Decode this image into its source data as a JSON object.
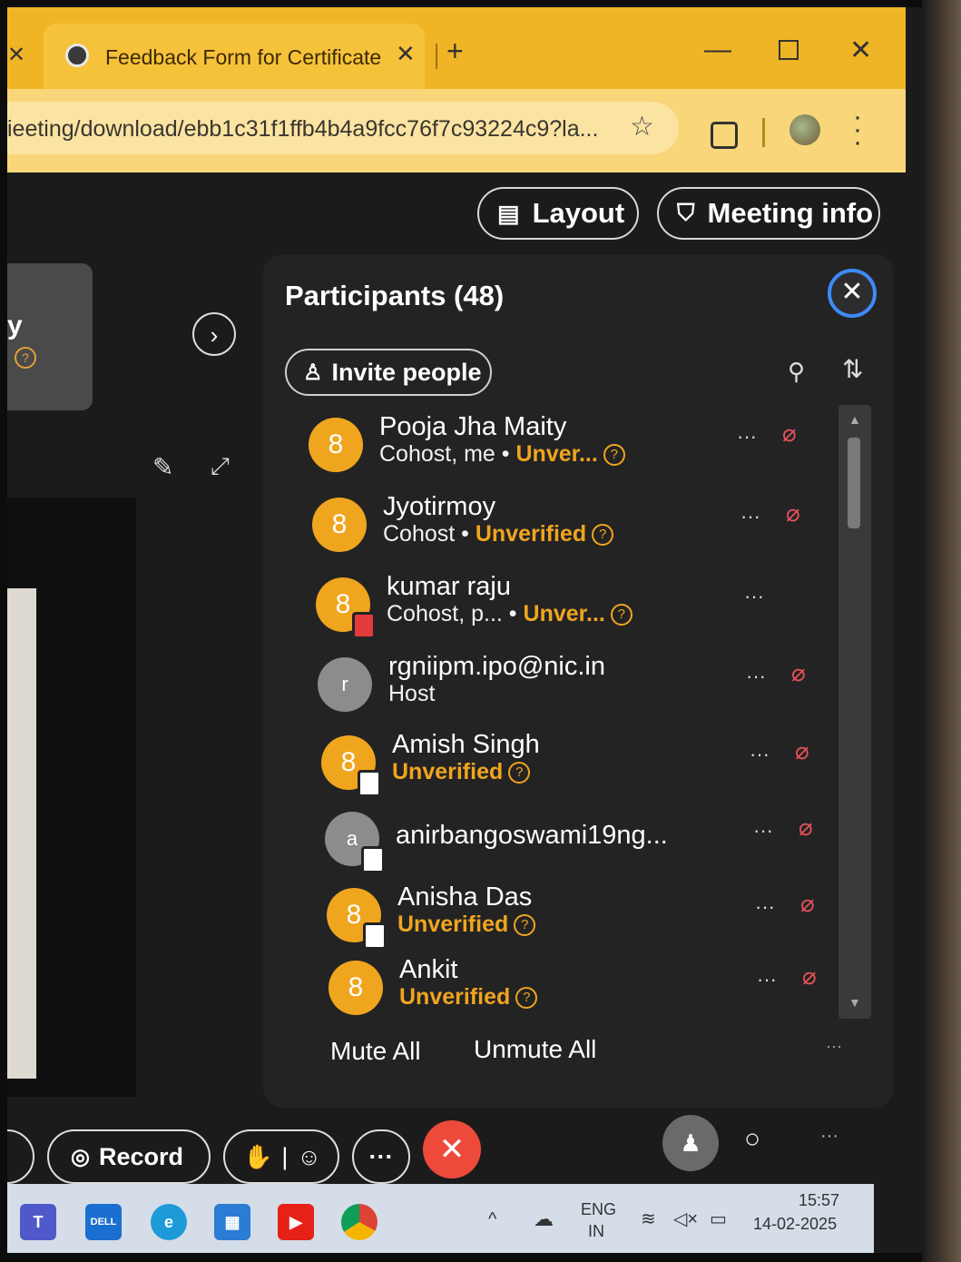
{
  "browser": {
    "tab_title": "Feedback Form for Certificate",
    "url": "ieeting/download/ebb1c31f1ffb4b4a9fcc76f7c93224c9?la..."
  },
  "meeting": {
    "layout_label": "Layout",
    "meeting_info_label": "Meeting info",
    "left_tile_initial": "y"
  },
  "participants": {
    "title": "Participants (48)",
    "invite_label": "Invite people",
    "items": [
      {
        "name": "Pooja Jha Maity",
        "role": "Cohost, me",
        "status": "Unver...",
        "avatar": "8",
        "badge": ""
      },
      {
        "name": "Jyotirmoy",
        "role": "Cohost",
        "status": "Unverified",
        "avatar": "8",
        "badge": ""
      },
      {
        "name": "kumar raju",
        "role": "Cohost, p...",
        "status": "Unver...",
        "avatar": "8",
        "badge": "red"
      },
      {
        "name": "rgniipm.ipo@nic.in",
        "role": "Host",
        "status": "",
        "avatar": "r",
        "badge": ""
      },
      {
        "name": "Amish Singh",
        "role": "",
        "status": "Unverified",
        "avatar": "8",
        "badge": "device"
      },
      {
        "name": "anirbangoswami19ng...",
        "role": "",
        "status": "",
        "avatar": "a",
        "badge": "device"
      },
      {
        "name": "Anisha Das",
        "role": "",
        "status": "Unverified",
        "avatar": "8",
        "badge": "device"
      },
      {
        "name": "Ankit",
        "role": "",
        "status": "Unverified",
        "avatar": "8",
        "badge": ""
      }
    ],
    "mute_all_label": "Mute All",
    "unmute_all_label": "Unmute All"
  },
  "controls": {
    "record_label": "Record"
  },
  "taskbar": {
    "lang_top": "ENG",
    "lang_bottom": "IN",
    "time": "15:57",
    "date": "14-02-2025"
  },
  "colors": {
    "tab_bar": "#f0b526",
    "accent_orange": "#f0a51e",
    "end_call_red": "#ee4a3b",
    "close_ring_blue": "#3d8af7"
  }
}
